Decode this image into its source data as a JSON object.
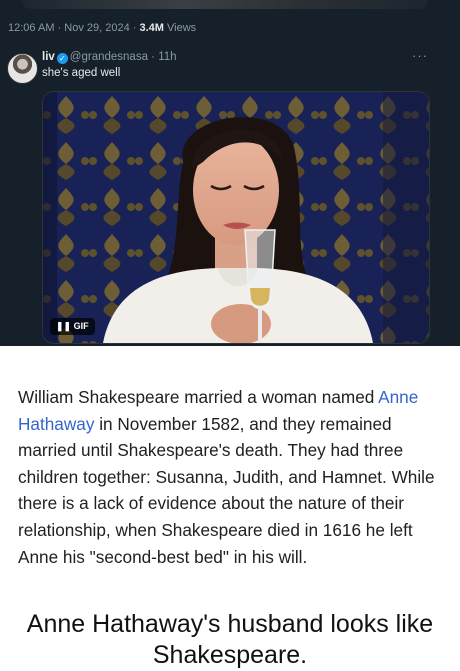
{
  "tweet": {
    "timestamp": "12:06 AM · Nov 29, 2024 · ",
    "views_count": "3.4M",
    "views_label": " Views",
    "author_name": "liv",
    "author_handle": "@grandesnasa",
    "time_ago": "· 11h",
    "text": "she's aged well",
    "more_label": "···",
    "media_badge": "❚❚  GIF"
  },
  "article": {
    "text_before_link": "William Shakespeare married a woman named ",
    "link_text": "Anne Hathaway",
    "text_after_link": " in November 1582, and they remained married until Shakespeare's death. They had three children together: Susanna, Judith, and Hamnet. While there is a lack of evidence about the nature of their relationship, when Shakespeare died in 1616 he left Anne his \"second-best bed\" in his will."
  },
  "caption": "Anne Hathaway's husband looks like Shakespeare."
}
